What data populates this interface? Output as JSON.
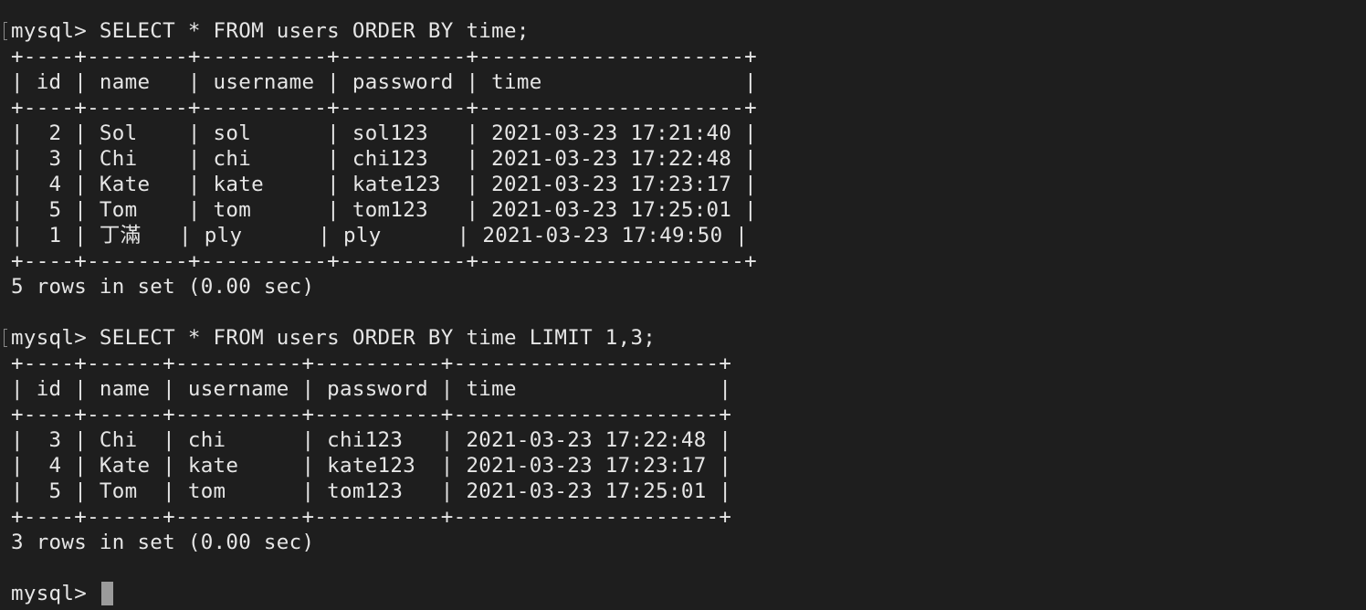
{
  "query1": {
    "command": "mysql> SELECT * FROM users ORDER BY time;",
    "table_lines": [
      "+----+--------+----------+----------+---------------------+",
      "| id | name   | username | password | time                |",
      "+----+--------+----------+----------+---------------------+",
      "|  2 | Sol    | sol      | sol123   | 2021-03-23 17:21:40 |",
      "|  3 | Chi    | chi      | chi123   | 2021-03-23 17:22:48 |",
      "|  4 | Kate   | kate     | kate123  | 2021-03-23 17:23:17 |",
      "|  5 | Tom    | tom      | tom123   | 2021-03-23 17:25:01 |",
      "|  1 | 丁滿   | ply      | ply      | 2021-03-23 17:49:50 |",
      "+----+--------+----------+----------+---------------------+"
    ],
    "result": "5 rows in set (0.00 sec)"
  },
  "query2": {
    "command": "mysql> SELECT * FROM users ORDER BY time LIMIT 1,3;",
    "table_lines": [
      "+----+------+----------+----------+---------------------+",
      "| id | name | username | password | time                |",
      "+----+------+----------+----------+---------------------+",
      "|  3 | Chi  | chi      | chi123   | 2021-03-23 17:22:48 |",
      "|  4 | Kate | kate     | kate123  | 2021-03-23 17:23:17 |",
      "|  5 | Tom  | tom      | tom123   | 2021-03-23 17:25:01 |",
      "+----+------+----------+----------+---------------------+"
    ],
    "result": "3 rows in set (0.00 sec)"
  },
  "prompt": "mysql> "
}
